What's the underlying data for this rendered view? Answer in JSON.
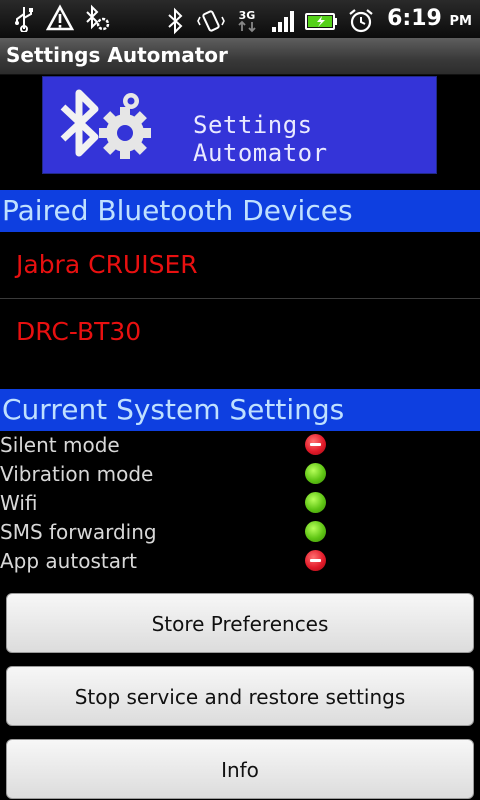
{
  "status_bar": {
    "time": "6:19",
    "ampm": "PM",
    "network": "3G",
    "icons_left": [
      "usb-icon",
      "warning-icon",
      "bluetooth-settings-icon"
    ],
    "icons_right": [
      "bluetooth-icon",
      "vibrate-icon",
      "3g-icon",
      "signal-icon",
      "battery-icon",
      "alarm-icon"
    ]
  },
  "app": {
    "title": "Settings Automator"
  },
  "banner": {
    "text": "Settings Automator",
    "logo_icon": "bluetooth-gear-logo"
  },
  "paired": {
    "header": "Paired Bluetooth Devices",
    "devices": [
      "Jabra CRUISER",
      "DRC-BT30"
    ]
  },
  "current": {
    "header": "Current System Settings",
    "settings": [
      {
        "label": "Silent mode",
        "state": "off"
      },
      {
        "label": "Vibration mode",
        "state": "on"
      },
      {
        "label": "Wifi",
        "state": "on"
      },
      {
        "label": "SMS forwarding",
        "state": "on"
      },
      {
        "label": "App autostart",
        "state": "off"
      }
    ]
  },
  "buttons": {
    "store": "Store Preferences",
    "stop": "Stop service and restore settings",
    "info": "Info"
  },
  "colors": {
    "section_header_bg": "#0e3fe0",
    "banner_bg": "#3434d8",
    "device_text": "#e81010",
    "status_on": "#5fc514",
    "status_off": "#e21b2a"
  }
}
